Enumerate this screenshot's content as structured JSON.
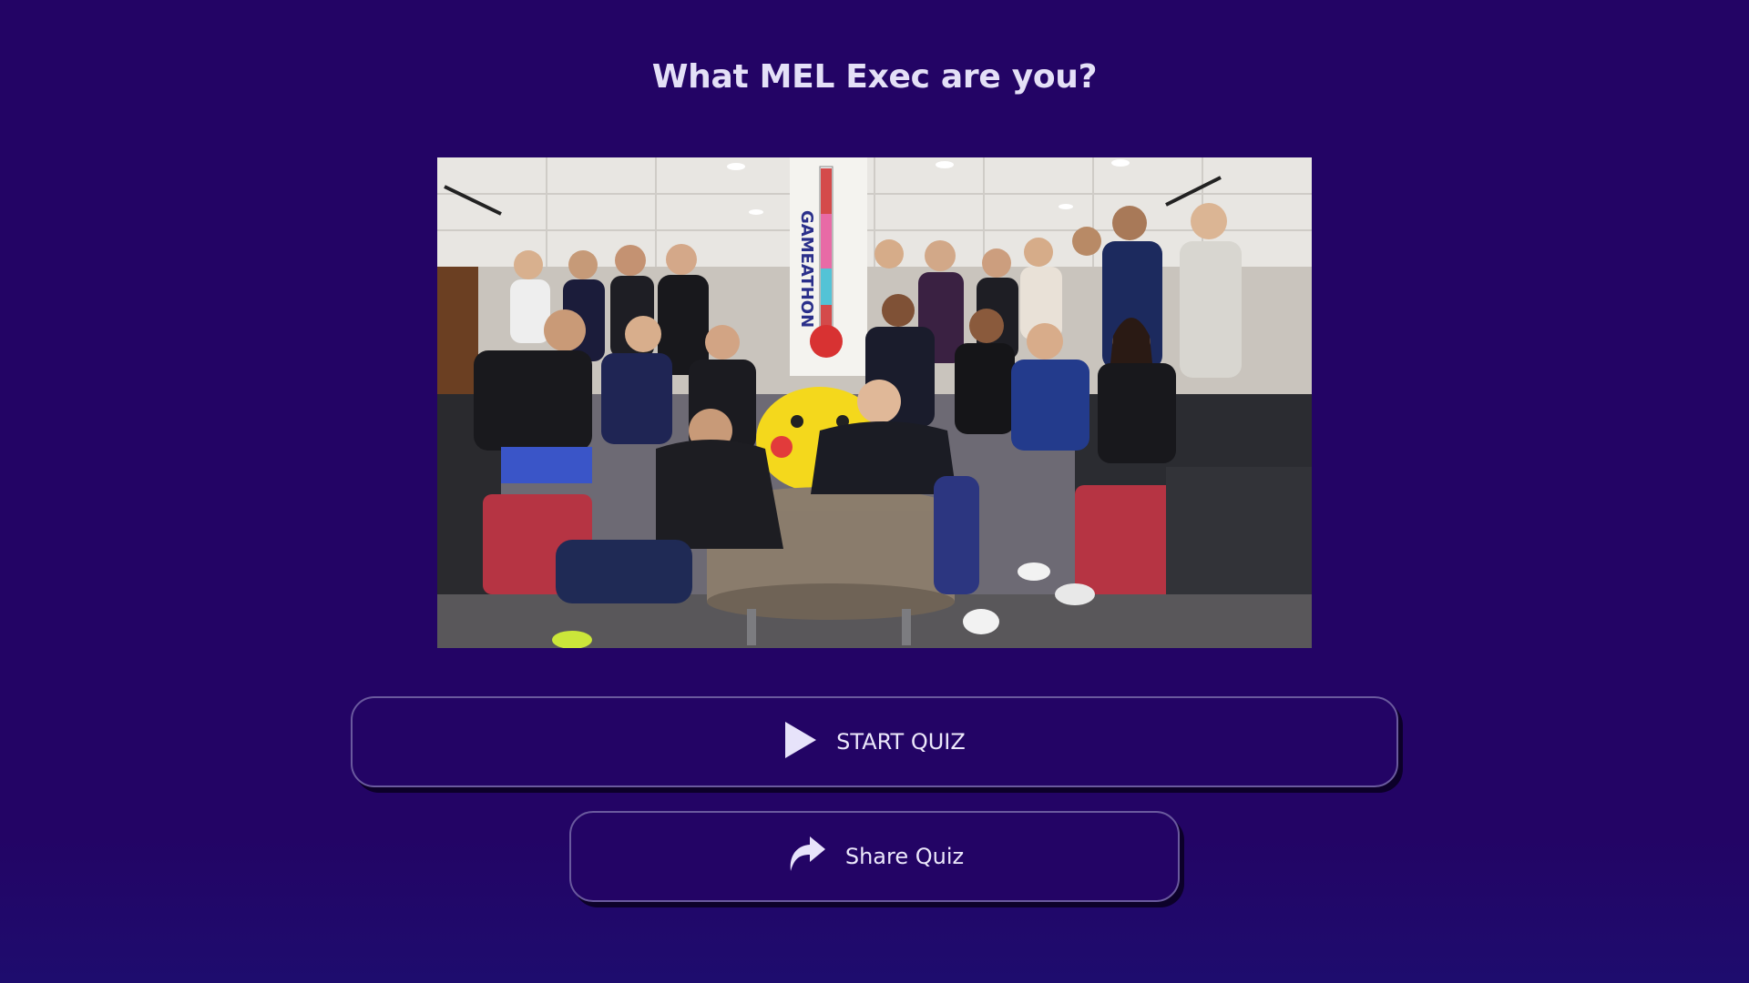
{
  "page": {
    "title": "What MEL Exec are you?"
  },
  "hero": {
    "banner_text": "GAMEATHON"
  },
  "actions": {
    "start_label": "START QUIZ",
    "start_icon": "play-icon",
    "share_label": "Share Quiz",
    "share_icon": "share-arrow-icon"
  },
  "colors": {
    "background": "#230465",
    "text": "#e4e0f7",
    "button_border": "#6a5a9e"
  }
}
